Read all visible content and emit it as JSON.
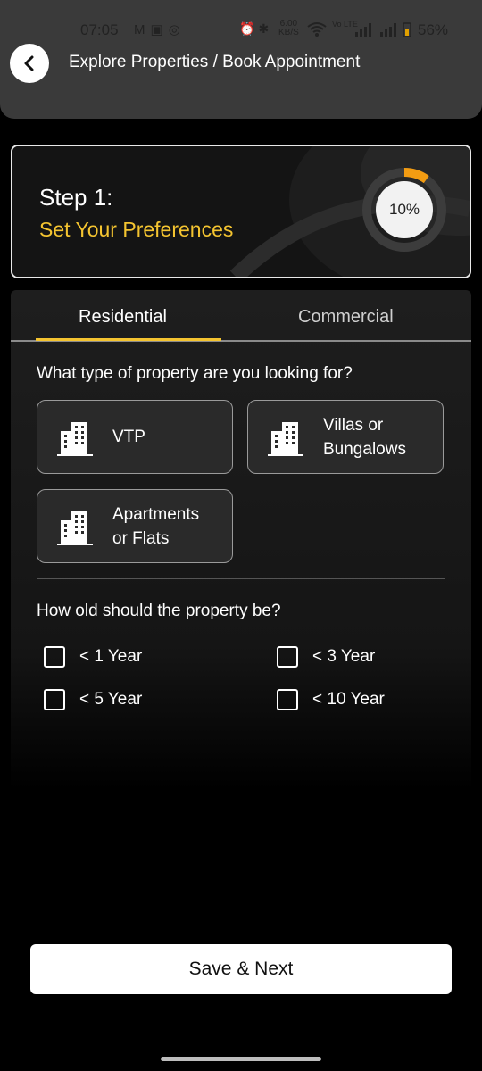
{
  "status_bar": {
    "time": "07:05",
    "left_icons": [
      "gmail-icon",
      "notification-icon",
      "app-icon"
    ],
    "speed_value": "6.00",
    "speed_unit": "KB/S",
    "network_label": "Vo LTE",
    "battery": "56%"
  },
  "header": {
    "title": "Explore Properties / Book Appointment"
  },
  "step": {
    "title": "Step 1:",
    "subtitle": "Set Your Preferences",
    "progress_label": "10%",
    "progress_value": 0.1
  },
  "tabs": [
    {
      "label": "Residential",
      "active": true
    },
    {
      "label": "Commercial",
      "active": false
    }
  ],
  "property_type": {
    "question": "What type of property are you looking for?",
    "options": [
      {
        "line1": "VTP",
        "line2": ""
      },
      {
        "line1": "Villas or",
        "line2": "Bungalows"
      },
      {
        "line1": "Apartments",
        "line2": "or Flats"
      }
    ]
  },
  "property_age": {
    "question": "How old should the property be?",
    "options": [
      {
        "label": "< 1 Year",
        "checked": false
      },
      {
        "label": "< 3 Year",
        "checked": false
      },
      {
        "label": "< 5 Year",
        "checked": false
      },
      {
        "label": "< 10 Year",
        "checked": false
      }
    ]
  },
  "actions": {
    "save_label": "Save & Next"
  },
  "colors": {
    "accent": "#f4c430",
    "progress": "#f39c12"
  }
}
